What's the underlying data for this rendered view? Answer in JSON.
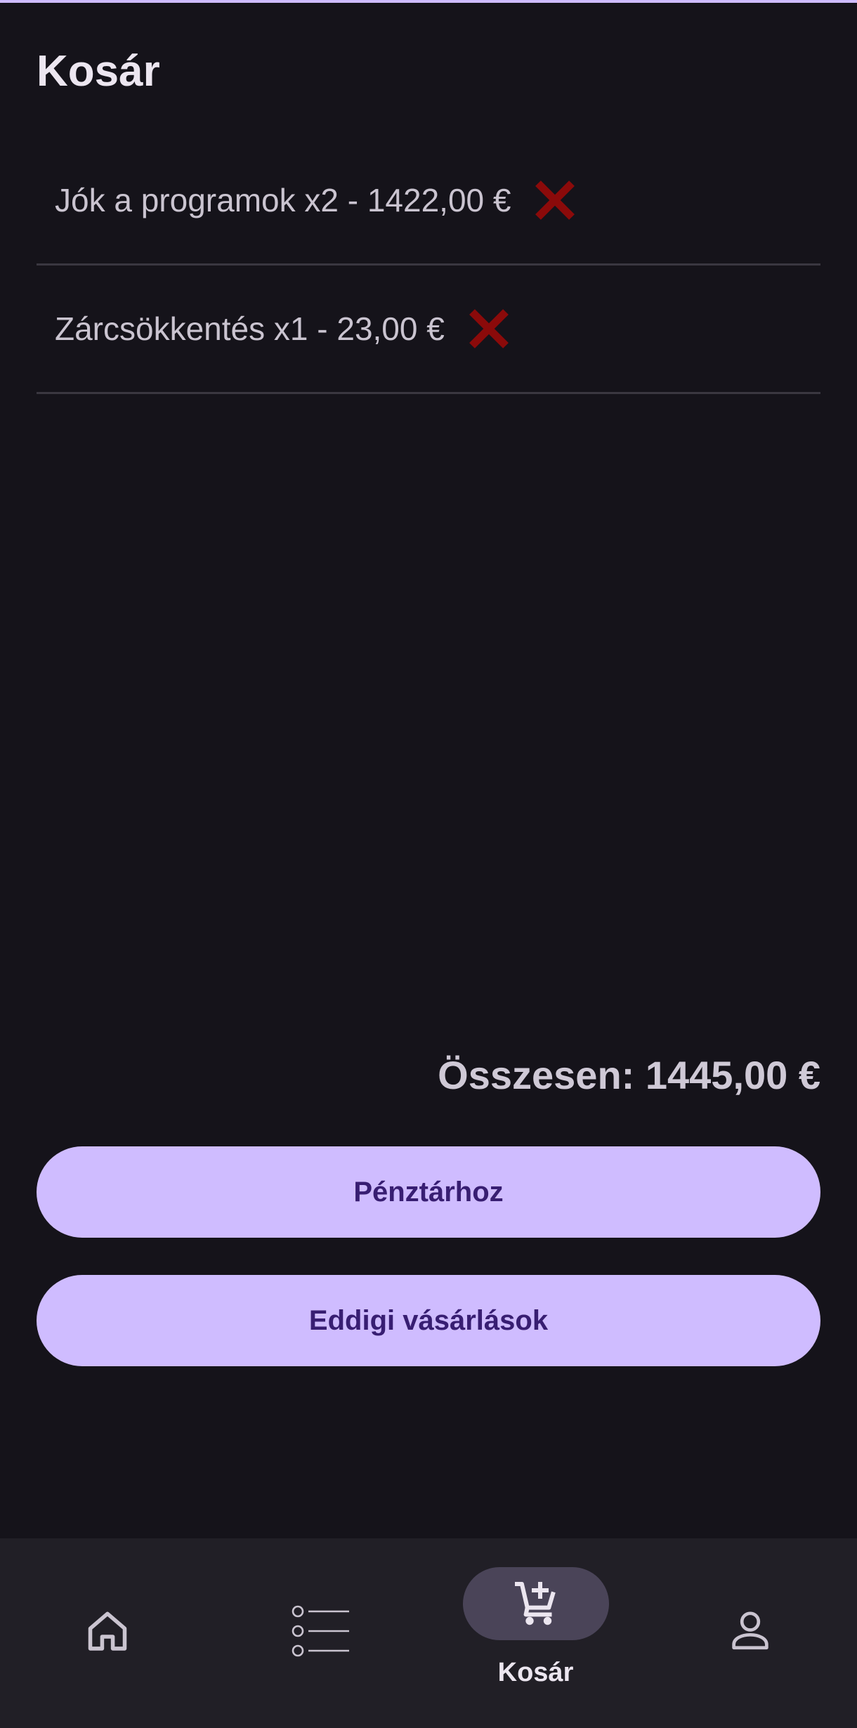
{
  "header": {
    "title": "Kosár"
  },
  "cart": {
    "items": [
      {
        "label": "Jók a programok x2 - 1422,00 €",
        "remove_icon": "close-icon"
      },
      {
        "label": "Zárcsökkentés x1 - 23,00 €",
        "remove_icon": "close-icon"
      }
    ],
    "total_label": "Összesen: 1445,00 €"
  },
  "actions": {
    "checkout_label": "Pénztárhoz",
    "history_label": "Eddigi vásárlások"
  },
  "bottom_nav": {
    "items": [
      {
        "icon": "home-icon",
        "label": "",
        "selected": false
      },
      {
        "icon": "list-icon",
        "label": "",
        "selected": false
      },
      {
        "icon": "cart-add-icon",
        "label": "Kosár",
        "selected": true
      },
      {
        "icon": "person-icon",
        "label": "",
        "selected": false
      }
    ]
  },
  "colors": {
    "background": "#15131a",
    "accent": "#cfbcff",
    "on_accent": "#381e72",
    "remove_icon": "#8b0a0a",
    "nav_background": "#211f26",
    "nav_selected_pill": "#4a4458"
  }
}
